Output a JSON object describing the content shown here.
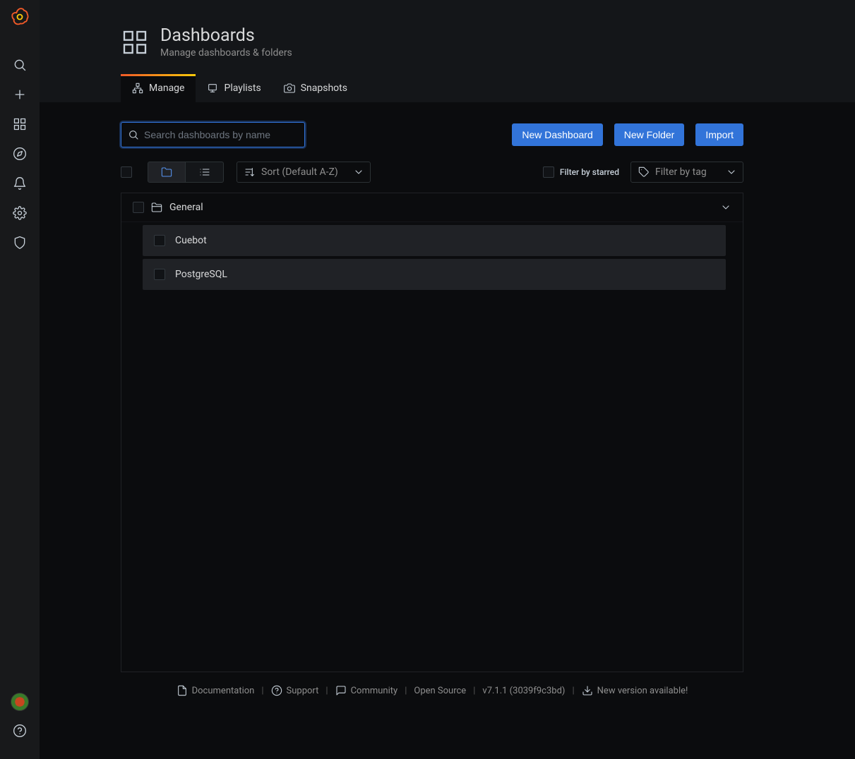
{
  "page": {
    "title": "Dashboards",
    "subtitle": "Manage dashboards & folders"
  },
  "tabs": [
    {
      "label": "Manage",
      "icon": "sitemap-icon",
      "active": true
    },
    {
      "label": "Playlists",
      "icon": "playlist-icon",
      "active": false
    },
    {
      "label": "Snapshots",
      "icon": "camera-icon",
      "active": false
    }
  ],
  "search": {
    "placeholder": "Search dashboards by name"
  },
  "buttons": {
    "new_dashboard": "New Dashboard",
    "new_folder": "New Folder",
    "import": "Import"
  },
  "filters": {
    "sort_label": "Sort (Default A-Z)",
    "starred_label": "Filter by starred",
    "tag_placeholder": "Filter by tag"
  },
  "folders": [
    {
      "name": "General",
      "expanded": true,
      "items": [
        {
          "name": "Cuebot"
        },
        {
          "name": "PostgreSQL"
        }
      ]
    }
  ],
  "footer": {
    "documentation": "Documentation",
    "support": "Support",
    "community": "Community",
    "edition": "Open Source",
    "version": "v7.1.1 (3039f9c3bd)",
    "update": "New version available!"
  }
}
